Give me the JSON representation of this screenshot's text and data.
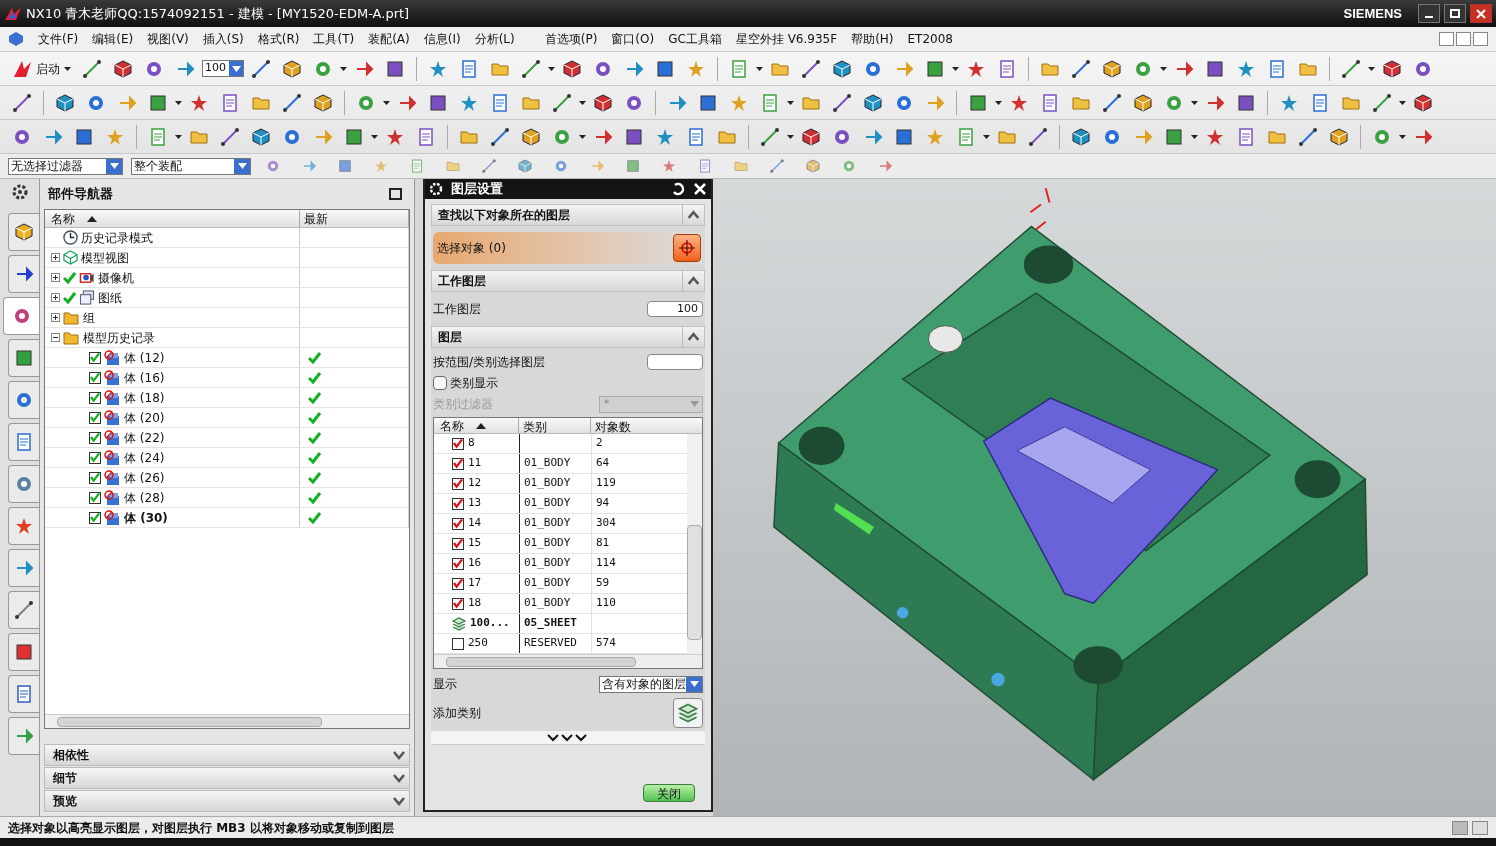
{
  "window": {
    "title": "NX10 青木老师QQ:1574092151 - 建模 - [MY1520-EDM-A.prt]",
    "brand": "SIEMENS"
  },
  "menu": [
    "文件(F)",
    "编辑(E)",
    "视图(V)",
    "插入(S)",
    "格式(R)",
    "工具(T)",
    "装配(A)",
    "信息(I)",
    "分析(L)",
    "首选项(P)",
    "窗口(O)",
    "GC工具箱",
    "星空外挂 V6.935F",
    "帮助(H)",
    "ET2008"
  ],
  "toolbar": {
    "start_label": "启动",
    "zoom_value": "100"
  },
  "selection_bar": {
    "filter": "无选择过滤器",
    "scope": "整个装配"
  },
  "resource_bar": [
    {
      "kind": "assembly",
      "selected": false
    },
    {
      "kind": "constraint",
      "selected": false
    },
    {
      "kind": "part",
      "selected": true
    },
    {
      "kind": "library",
      "selected": false
    },
    {
      "kind": "info",
      "selected": false
    },
    {
      "kind": "web",
      "selected": false
    },
    {
      "kind": "history",
      "selected": false
    },
    {
      "kind": "palette",
      "selected": false
    },
    {
      "kind": "role",
      "selected": false
    },
    {
      "kind": "robot",
      "selected": false
    },
    {
      "kind": "process",
      "selected": false
    },
    {
      "kind": "list",
      "selected": false
    },
    {
      "kind": "export",
      "selected": false
    }
  ],
  "navigator": {
    "title": "部件导航器",
    "columns": [
      "名称",
      "最新"
    ],
    "tree": [
      {
        "label": "历史记录模式",
        "kind": "clock"
      },
      {
        "label": "模型视图",
        "kind": "view",
        "expanded": false
      },
      {
        "label": "摄像机",
        "kind": "camera",
        "expanded": false,
        "checked": true
      },
      {
        "label": "图纸",
        "kind": "drawing",
        "expanded": false,
        "checked": true
      },
      {
        "label": "组",
        "kind": "folder",
        "expanded": false
      },
      {
        "label": "模型历史记录",
        "kind": "folder",
        "expanded": true,
        "children": [
          {
            "label": "体 (12)",
            "kind": "body",
            "checked": true,
            "latest": true,
            "current": false
          },
          {
            "label": "体 (16)",
            "kind": "body",
            "checked": true,
            "latest": true,
            "current": false
          },
          {
            "label": "体 (18)",
            "kind": "body",
            "checked": true,
            "latest": true,
            "current": false
          },
          {
            "label": "体 (20)",
            "kind": "body",
            "checked": true,
            "latest": true,
            "current": false
          },
          {
            "label": "体 (22)",
            "kind": "body",
            "checked": true,
            "latest": true,
            "current": false
          },
          {
            "label": "体 (24)",
            "kind": "body",
            "checked": true,
            "latest": true,
            "current": false
          },
          {
            "label": "体 (26)",
            "kind": "body",
            "checked": true,
            "latest": true,
            "current": false
          },
          {
            "label": "体 (28)",
            "kind": "body",
            "checked": true,
            "latest": true,
            "current": false
          },
          {
            "label": "体 (30)",
            "kind": "body",
            "checked": true,
            "latest": true,
            "current": true
          }
        ]
      }
    ],
    "panels": [
      {
        "label": "相依性",
        "expanded": false
      },
      {
        "label": "细节",
        "expanded": false
      },
      {
        "label": "预览",
        "expanded": false
      }
    ]
  },
  "dialog": {
    "title": "图层设置",
    "find_section": {
      "title": "查找以下对象所在的图层",
      "expanded": true,
      "select_label": "选择对象 (0)"
    },
    "work_section": {
      "title": "工作图层",
      "expanded": true,
      "label": "工作图层",
      "value": "100"
    },
    "layers_section": {
      "title": "图层",
      "expanded": true,
      "range_label": "按范围/类别选择图层",
      "category_display": {
        "label": "类别显示",
        "checked": false
      },
      "category_filter": {
        "label": "类别过滤器",
        "value": "*",
        "disabled": true
      },
      "columns": [
        "名称",
        "类别",
        "对象数"
      ],
      "rows": [
        {
          "name": "8",
          "count": "2",
          "kind": "layer",
          "checked": true
        },
        {
          "name": "11",
          "category": "01_BODY",
          "count": "64",
          "kind": "layer",
          "checked": true
        },
        {
          "name": "12",
          "category": "01_BODY",
          "count": "119",
          "kind": "layer",
          "checked": true
        },
        {
          "name": "13",
          "category": "01_BODY",
          "count": "94",
          "kind": "layer",
          "checked": true
        },
        {
          "name": "14",
          "category": "01_BODY",
          "count": "304",
          "kind": "layer",
          "checked": true
        },
        {
          "name": "15",
          "category": "01_BODY",
          "count": "81",
          "kind": "layer",
          "checked": true
        },
        {
          "name": "16",
          "category": "01_BODY",
          "count": "114",
          "kind": "layer",
          "checked": true
        },
        {
          "name": "17",
          "category": "01_BODY",
          "count": "59",
          "kind": "layer",
          "checked": true
        },
        {
          "name": "18",
          "category": "01_BODY",
          "count": "110",
          "kind": "layer",
          "checked": true
        },
        {
          "name": "100...",
          "category": "05_SHEET",
          "kind": "work"
        },
        {
          "name": "250",
          "category": "RESERVED",
          "count": "574",
          "kind": "layer",
          "checked": false
        }
      ],
      "show_label": "显示",
      "show_value": "含有对象的图层",
      "add_category_label": "添加类别"
    },
    "close_button": "关闭"
  },
  "status_bar": {
    "message": "选择对象以高亮显示图层，对图层执行 MB3 以将对象移动或复制到图层"
  }
}
